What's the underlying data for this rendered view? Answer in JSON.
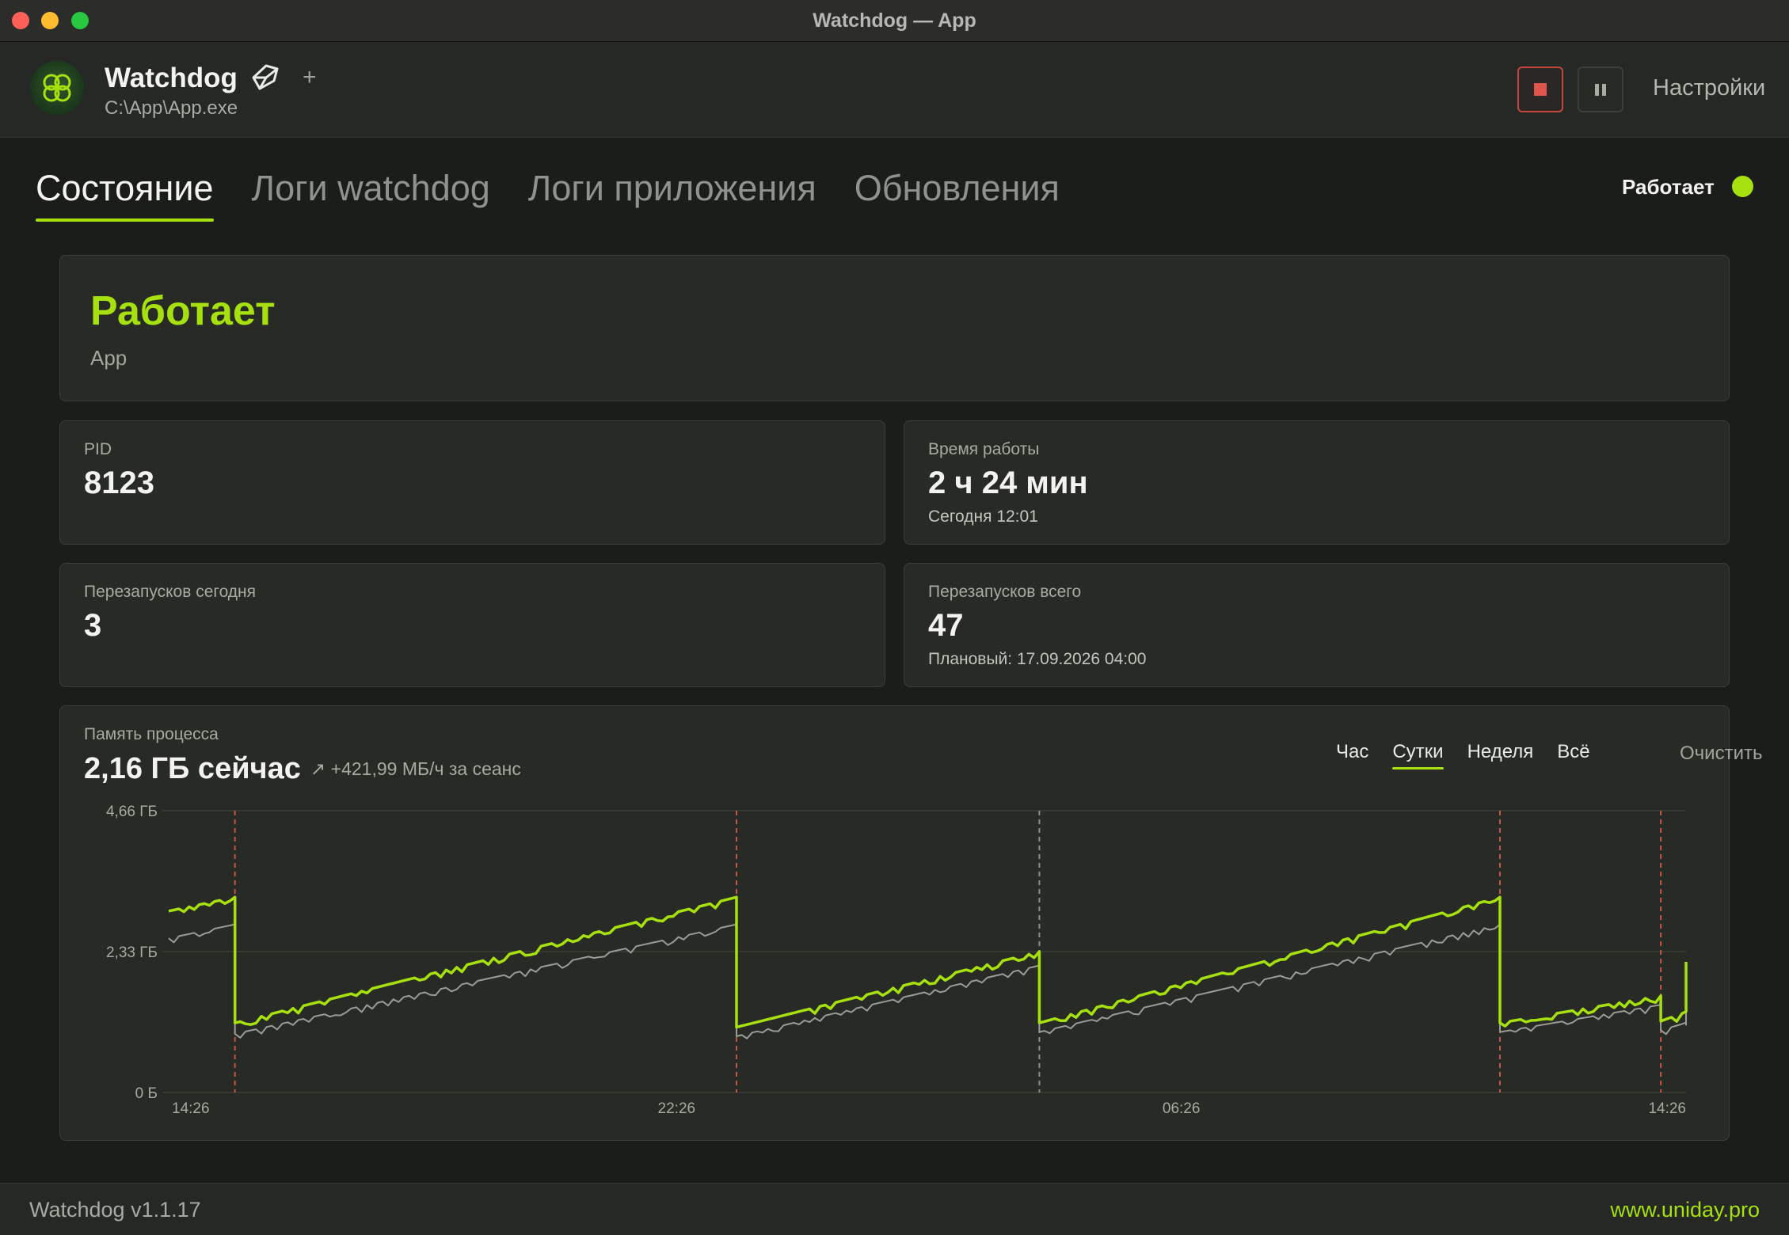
{
  "window": {
    "title": "Watchdog — App"
  },
  "header": {
    "app_name": "Watchdog",
    "app_path": "C:\\App\\App.exe",
    "add_label": "+",
    "settings_label": "Настройки"
  },
  "tabs": [
    {
      "label": "Состояние",
      "active": true
    },
    {
      "label": "Логи watchdog",
      "active": false
    },
    {
      "label": "Логи приложения",
      "active": false
    },
    {
      "label": "Обновления",
      "active": false
    }
  ],
  "status": {
    "label": "Работает",
    "color": "#a6e10f"
  },
  "hero": {
    "title": "Работает",
    "subtitle": "App"
  },
  "stats": {
    "pid": {
      "label": "PID",
      "value": "8123"
    },
    "uptime": {
      "label": "Время работы",
      "value": "2 ч 24 мин",
      "sub": "Сегодня 12:01"
    },
    "restarts_today": {
      "label": "Перезапусков сегодня",
      "value": "3"
    },
    "restarts_total": {
      "label": "Перезапусков всего",
      "value": "47",
      "sub": "Плановый: 17.09.2026 04:00"
    }
  },
  "memory": {
    "label": "Память процесса",
    "value": "2,16 ГБ сейчас",
    "trend": "↗ +421,99 МБ/ч за сеанс",
    "ranges": [
      {
        "label": "Час",
        "active": false
      },
      {
        "label": "Сутки",
        "active": true
      },
      {
        "label": "Неделя",
        "active": false
      },
      {
        "label": "Всё",
        "active": false
      }
    ],
    "clear_label": "Очистить"
  },
  "colors": {
    "accent": "#a6e10f",
    "danger": "#e0554c",
    "secondary_line": "#9a9c97"
  },
  "chart_data": {
    "type": "line",
    "y_tick_labels": [
      "0 Б",
      "2,33 ГБ",
      "4,66 ГБ"
    ],
    "ylim": [
      0,
      4.66
    ],
    "x_tick_labels": [
      "14:26",
      "22:26",
      "06:26",
      "14:26"
    ],
    "x_hours_range": [
      0,
      24
    ],
    "x_tick_hours": [
      0,
      8,
      16,
      24
    ],
    "grid": true,
    "restart_markers": [
      {
        "hour": 1.0,
        "kind": "crash"
      },
      {
        "hour": 8.95,
        "kind": "crash"
      },
      {
        "hour": 13.75,
        "kind": "planned"
      },
      {
        "hour": 21.05,
        "kind": "crash"
      },
      {
        "hour": 23.6,
        "kind": "crash"
      }
    ],
    "series": [
      {
        "segments": [
          [
            [
              -0.05,
              3.0
            ],
            [
              1.0,
              3.23
            ]
          ],
          [
            [
              1.0,
              1.15
            ],
            [
              8.95,
              3.23
            ]
          ],
          [
            [
              8.95,
              1.08
            ],
            [
              13.75,
              2.33
            ]
          ],
          [
            [
              13.75,
              1.15
            ],
            [
              21.05,
              3.23
            ]
          ],
          [
            [
              21.05,
              1.15
            ],
            [
              23.6,
              1.6
            ]
          ],
          [
            [
              23.6,
              1.18
            ],
            [
              26.2,
              2.16
            ]
          ]
        ]
      },
      {
        "offset": -0.45,
        "segments": [
          [
            [
              -0.05,
              2.55
            ],
            [
              1.0,
              2.78
            ]
          ],
          [
            [
              1.0,
              0.97
            ],
            [
              8.95,
              2.78
            ]
          ],
          [
            [
              8.95,
              0.93
            ],
            [
              13.75,
              2.1
            ]
          ],
          [
            [
              13.75,
              1.0
            ],
            [
              21.05,
              2.78
            ]
          ],
          [
            [
              21.05,
              1.0
            ],
            [
              23.6,
              1.45
            ]
          ],
          [
            [
              23.6,
              1.03
            ],
            [
              26.2,
              1.82
            ]
          ]
        ]
      }
    ]
  }
}
